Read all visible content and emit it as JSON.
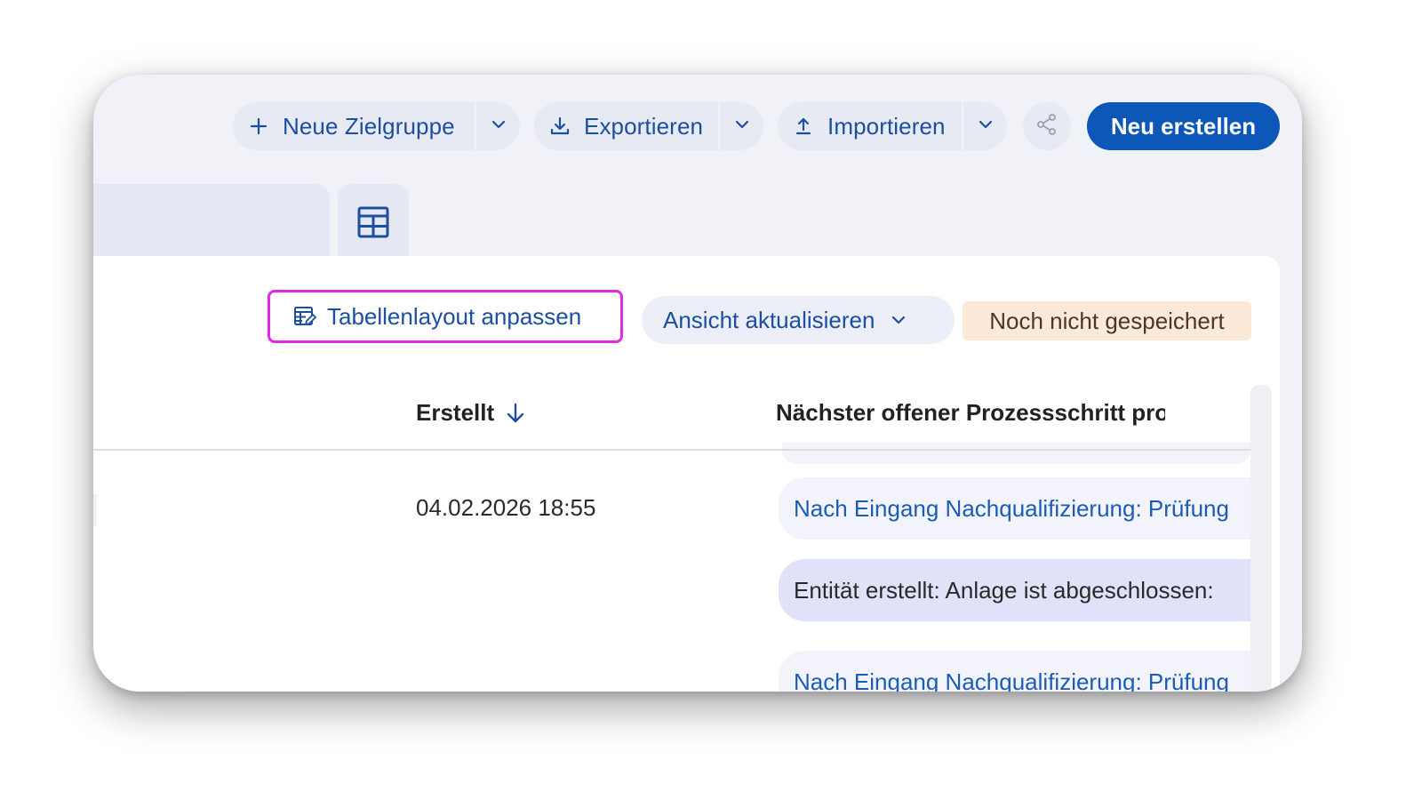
{
  "toolbar": {
    "new_audience_label": "Neue Zielgruppe",
    "export_label": "Exportieren",
    "import_label": "Importieren",
    "create_new_label": "Neu erstellen"
  },
  "table_actions": {
    "customize_layout_label": "Tabellenlayout anpassen",
    "update_view_label": "Ansicht aktualisieren",
    "unsaved_status": "Noch nicht gespeichert"
  },
  "table": {
    "columns": [
      {
        "label": "Erstellt",
        "sorted": "descending"
      },
      {
        "label": "Nächster offener Prozessschritt pro"
      }
    ],
    "rows": [
      {
        "created": "04.02.2026 18:55",
        "steps": [
          "Nach Eingang Nachqualifizierung: Prüfung",
          "Entität erstellt: Anlage ist abgeschlossen:",
          "Nach Eingang Nachqualifizierung: Prüfung"
        ]
      }
    ]
  },
  "colors": {
    "accent": "#1c4fa0",
    "primary_button": "#0c57b8",
    "focus_outline": "#e02be6",
    "unsaved_badge_bg": "#fde9d8",
    "step_highlight_bg": "#dfe2f8"
  },
  "icons": {
    "new_audience": "plus-icon",
    "export": "download-icon",
    "import": "upload-icon",
    "dropdown": "chevron-down-icon",
    "share": "share-icon",
    "table_view": "table-icon",
    "layout": "table-edit-icon",
    "sort": "arrow-down-icon"
  }
}
